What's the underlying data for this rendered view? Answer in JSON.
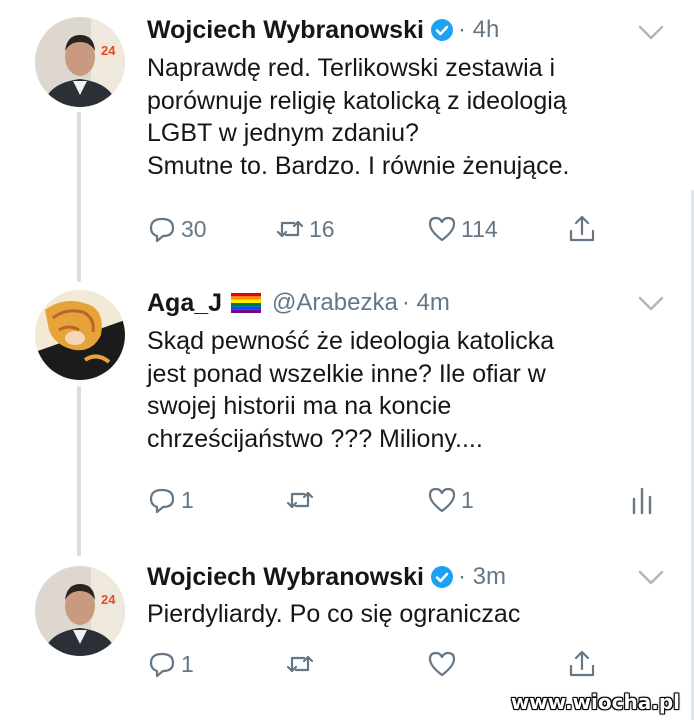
{
  "tweets": [
    {
      "author": "Wojciech Wybranowski",
      "handle": "",
      "time": "· 4h",
      "verified": true,
      "lines": [
        "Naprawdę red. Terlikowski zestawia i",
        "porównuje religię katolicką z ideologią",
        "LGBT w jednym zdaniu?",
        "Smutne to. Bardzo. I równie żenujące."
      ],
      "replies": "30",
      "retweets": "16",
      "likes": "114",
      "last_icon": "share-icon"
    },
    {
      "author": "Aga_J",
      "handle": "@Arabezka",
      "time": "· 4m",
      "verified": false,
      "lines": [
        "Skąd pewność że ideologia katolicka",
        "jest ponad wszelkie inne? Ile ofiar w",
        "swojej historii ma na koncie",
        "chrześcijaństwo ??? Miliony...."
      ],
      "replies": "1",
      "retweets": "",
      "likes": "1",
      "last_icon": "analytics-icon"
    },
    {
      "author": "Wojciech Wybranowski",
      "handle": "",
      "time": "· 3m",
      "verified": true,
      "lines": [
        "Pierdyliardy. Po co się ograniczac"
      ],
      "replies": "1",
      "retweets": "",
      "likes": "",
      "last_icon": "share-icon"
    }
  ],
  "watermark": "www.wiocha.pl",
  "colors": {
    "text": "#14171a",
    "secondary": "#657786",
    "verified": "#1da1f2",
    "thread_line": "#d6dde2"
  }
}
